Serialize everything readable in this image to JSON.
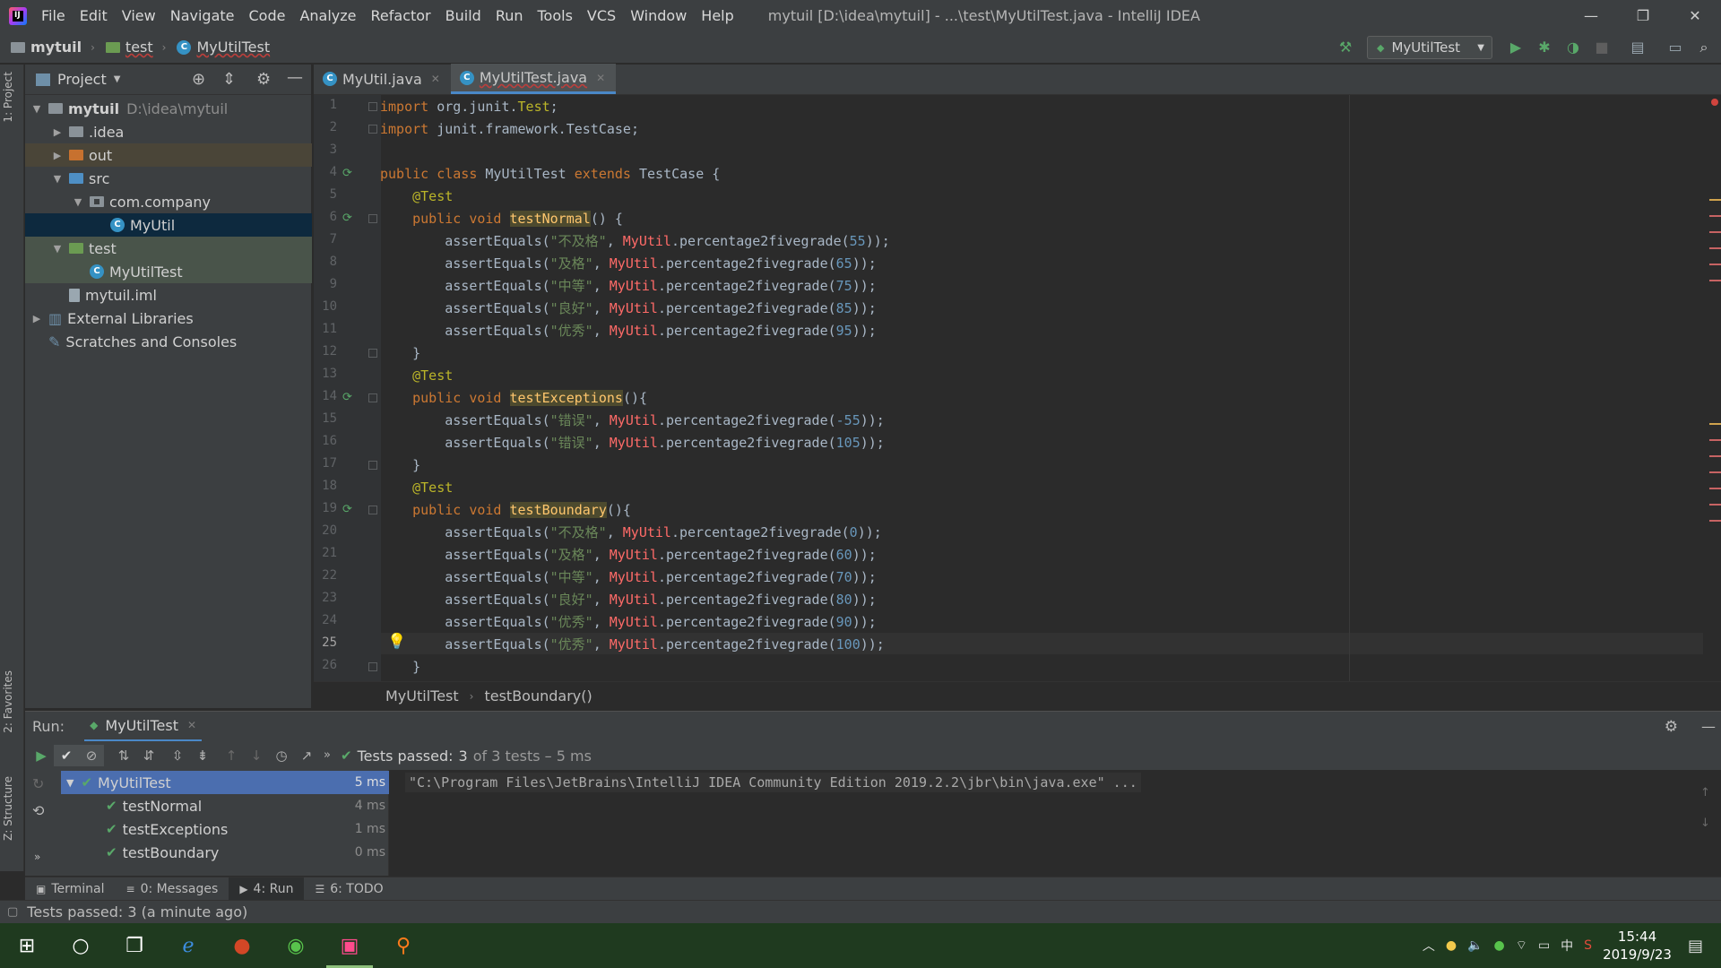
{
  "title_bar": {
    "menus": [
      "File",
      "Edit",
      "View",
      "Navigate",
      "Code",
      "Analyze",
      "Refactor",
      "Build",
      "Run",
      "Tools",
      "VCS",
      "Window",
      "Help"
    ],
    "window_title": "mytuil [D:\\idea\\mytuil] - ...\\test\\MyUtilTest.java - IntelliJ IDEA",
    "controls": [
      "—",
      "❐",
      "✕"
    ]
  },
  "nav_bar": {
    "crumbs": [
      "mytuil",
      "test",
      "MyUtilTest"
    ],
    "run_config": "MyUtilTest"
  },
  "left_strip": {
    "tabs": [
      "1: Project",
      "2: Favorites",
      "Z: Structure"
    ]
  },
  "project_panel": {
    "title": "Project",
    "tree": [
      {
        "label": "mytuil",
        "path": "D:\\idea\\mytuil",
        "arrow": "▼",
        "icon": "folder-icon",
        "depth": 0
      },
      {
        "label": ".idea",
        "arrow": "▶",
        "icon": "folder-icon",
        "depth": 1
      },
      {
        "label": "out",
        "arrow": "▶",
        "icon": "folder-orange-icon",
        "depth": 1
      },
      {
        "label": "src",
        "arrow": "▼",
        "icon": "folder-blue-icon",
        "depth": 1
      },
      {
        "label": "com.company",
        "arrow": "▼",
        "icon": "package-icon",
        "depth": 2
      },
      {
        "label": "MyUtil",
        "arrow": "",
        "icon": "class-icon",
        "depth": 3
      },
      {
        "label": "test",
        "arrow": "▼",
        "icon": "folder-green-icon",
        "depth": 1
      },
      {
        "label": "MyUtilTest",
        "arrow": "",
        "icon": "class-icon",
        "depth": 2
      },
      {
        "label": "mytuil.iml",
        "arrow": "",
        "icon": "iml-icon",
        "depth": 1
      },
      {
        "label": "External Libraries",
        "arrow": "▶",
        "icon": "library-icon",
        "depth": 0
      },
      {
        "label": "Scratches and Consoles",
        "arrow": "",
        "icon": "scratch-icon",
        "depth": 0
      }
    ]
  },
  "editor": {
    "tabs": [
      {
        "label": "MyUtil.java",
        "active": false
      },
      {
        "label": "MyUtilTest.java",
        "active": true
      }
    ],
    "line_numbers": [
      "1",
      "2",
      "3",
      "4",
      "5",
      "6",
      "7",
      "8",
      "9",
      "10",
      "11",
      "12",
      "13",
      "14",
      "15",
      "16",
      "17",
      "18",
      "19",
      "20",
      "21",
      "22",
      "23",
      "24",
      "25",
      "26"
    ],
    "lines": [
      [
        [
          "kw",
          "import "
        ],
        [
          "fn",
          "org.junit."
        ],
        [
          "ann",
          "Test"
        ],
        [
          "fn",
          ";"
        ]
      ],
      [
        [
          "kw",
          "import "
        ],
        [
          "fn",
          "junit.framework.TestCase;"
        ]
      ],
      [],
      [
        [
          "kw",
          "public class "
        ],
        [
          "fn",
          "MyUtilTest "
        ],
        [
          "kw",
          "extends "
        ],
        [
          "fn",
          "TestCase {"
        ]
      ],
      [
        [
          "fn",
          "    "
        ],
        [
          "ann",
          "@Test"
        ]
      ],
      [
        [
          "fn",
          "    "
        ],
        [
          "kw",
          "public void "
        ],
        [
          "method",
          "testNormal"
        ],
        [
          "fn",
          "() {"
        ]
      ],
      [
        [
          "fn",
          "        assertEquals("
        ],
        [
          "str",
          "\"不及格\""
        ],
        [
          "fn",
          ", "
        ],
        [
          "cls",
          "MyUtil"
        ],
        [
          "fn",
          ".percentage2fivegrade("
        ],
        [
          "num",
          "55"
        ],
        [
          "fn",
          "));"
        ]
      ],
      [
        [
          "fn",
          "        assertEquals("
        ],
        [
          "str",
          "\"及格\""
        ],
        [
          "fn",
          ", "
        ],
        [
          "cls",
          "MyUtil"
        ],
        [
          "fn",
          ".percentage2fivegrade("
        ],
        [
          "num",
          "65"
        ],
        [
          "fn",
          "));"
        ]
      ],
      [
        [
          "fn",
          "        assertEquals("
        ],
        [
          "str",
          "\"中等\""
        ],
        [
          "fn",
          ", "
        ],
        [
          "cls",
          "MyUtil"
        ],
        [
          "fn",
          ".percentage2fivegrade("
        ],
        [
          "num",
          "75"
        ],
        [
          "fn",
          "));"
        ]
      ],
      [
        [
          "fn",
          "        assertEquals("
        ],
        [
          "str",
          "\"良好\""
        ],
        [
          "fn",
          ", "
        ],
        [
          "cls",
          "MyUtil"
        ],
        [
          "fn",
          ".percentage2fivegrade("
        ],
        [
          "num",
          "85"
        ],
        [
          "fn",
          "));"
        ]
      ],
      [
        [
          "fn",
          "        assertEquals("
        ],
        [
          "str",
          "\"优秀\""
        ],
        [
          "fn",
          ", "
        ],
        [
          "cls",
          "MyUtil"
        ],
        [
          "fn",
          ".percentage2fivegrade("
        ],
        [
          "num",
          "95"
        ],
        [
          "fn",
          "));"
        ]
      ],
      [
        [
          "fn",
          "    }"
        ]
      ],
      [
        [
          "fn",
          "    "
        ],
        [
          "ann",
          "@Test"
        ]
      ],
      [
        [
          "fn",
          "    "
        ],
        [
          "kw",
          "public void "
        ],
        [
          "method",
          "testExceptions"
        ],
        [
          "fn",
          "(){"
        ]
      ],
      [
        [
          "fn",
          "        assertEquals("
        ],
        [
          "str",
          "\"错误\""
        ],
        [
          "fn",
          ", "
        ],
        [
          "cls",
          "MyUtil"
        ],
        [
          "fn",
          ".percentage2fivegrade("
        ],
        [
          "num",
          "-55"
        ],
        [
          "fn",
          "));"
        ]
      ],
      [
        [
          "fn",
          "        assertEquals("
        ],
        [
          "str",
          "\"错误\""
        ],
        [
          "fn",
          ", "
        ],
        [
          "cls",
          "MyUtil"
        ],
        [
          "fn",
          ".percentage2fivegrade("
        ],
        [
          "num",
          "105"
        ],
        [
          "fn",
          "));"
        ]
      ],
      [
        [
          "fn",
          "    }"
        ]
      ],
      [
        [
          "fn",
          "    "
        ],
        [
          "ann",
          "@Test"
        ]
      ],
      [
        [
          "fn",
          "    "
        ],
        [
          "kw",
          "public void "
        ],
        [
          "method",
          "testBoundary"
        ],
        [
          "fn",
          "(){"
        ]
      ],
      [
        [
          "fn",
          "        assertEquals("
        ],
        [
          "str",
          "\"不及格\""
        ],
        [
          "fn",
          ", "
        ],
        [
          "cls",
          "MyUtil"
        ],
        [
          "fn",
          ".percentage2fivegrade("
        ],
        [
          "num",
          "0"
        ],
        [
          "fn",
          "));"
        ]
      ],
      [
        [
          "fn",
          "        assertEquals("
        ],
        [
          "str",
          "\"及格\""
        ],
        [
          "fn",
          ", "
        ],
        [
          "cls",
          "MyUtil"
        ],
        [
          "fn",
          ".percentage2fivegrade("
        ],
        [
          "num",
          "60"
        ],
        [
          "fn",
          "));"
        ]
      ],
      [
        [
          "fn",
          "        assertEquals("
        ],
        [
          "str",
          "\"中等\""
        ],
        [
          "fn",
          ", "
        ],
        [
          "cls",
          "MyUtil"
        ],
        [
          "fn",
          ".percentage2fivegrade("
        ],
        [
          "num",
          "70"
        ],
        [
          "fn",
          "));"
        ]
      ],
      [
        [
          "fn",
          "        assertEquals("
        ],
        [
          "str",
          "\"良好\""
        ],
        [
          "fn",
          ", "
        ],
        [
          "cls",
          "MyUtil"
        ],
        [
          "fn",
          ".percentage2fivegrade("
        ],
        [
          "num",
          "80"
        ],
        [
          "fn",
          "));"
        ]
      ],
      [
        [
          "fn",
          "        assertEquals("
        ],
        [
          "str",
          "\"优秀\""
        ],
        [
          "fn",
          ", "
        ],
        [
          "cls",
          "MyUtil"
        ],
        [
          "fn",
          ".percentage2fivegrade("
        ],
        [
          "num",
          "90"
        ],
        [
          "fn",
          "));"
        ]
      ],
      [
        [
          "fn",
          "        assertEquals("
        ],
        [
          "str",
          "\"优秀\""
        ],
        [
          "fn",
          ", "
        ],
        [
          "cls",
          "MyUtil"
        ],
        [
          "fn",
          ".percentage2fivegrade("
        ],
        [
          "num",
          "100"
        ],
        [
          "fn",
          "));"
        ]
      ],
      [
        [
          "fn",
          "    }"
        ]
      ]
    ],
    "breadcrumb": [
      "MyUtilTest",
      "testBoundary()"
    ]
  },
  "run_panel": {
    "label": "Run:",
    "tab": "MyUtilTest",
    "status_prefix": "Tests passed:",
    "status_count": "3",
    "status_suffix": "of 3 tests – 5 ms",
    "tests": [
      {
        "name": "MyUtilTest",
        "time": "5 ms"
      },
      {
        "name": "testNormal",
        "time": "4 ms"
      },
      {
        "name": "testExceptions",
        "time": "1 ms"
      },
      {
        "name": "testBoundary",
        "time": "0 ms"
      }
    ],
    "console_line": "\"C:\\Program Files\\JetBrains\\IntelliJ IDEA Community Edition 2019.2.2\\jbr\\bin\\java.exe\" ..."
  },
  "tool_tabs": [
    "Terminal",
    "0: Messages",
    "4: Run",
    "6: TODO"
  ],
  "status_bar": {
    "text": "Tests passed: 3 (a minute ago)"
  },
  "taskbar": {
    "time": "15:44",
    "date": "2019/9/23",
    "ime": "中"
  },
  "colors": {
    "accent": "#4a88c7",
    "pass": "#59a869",
    "background": "#2b2b2b",
    "panel": "#3c3f41"
  }
}
